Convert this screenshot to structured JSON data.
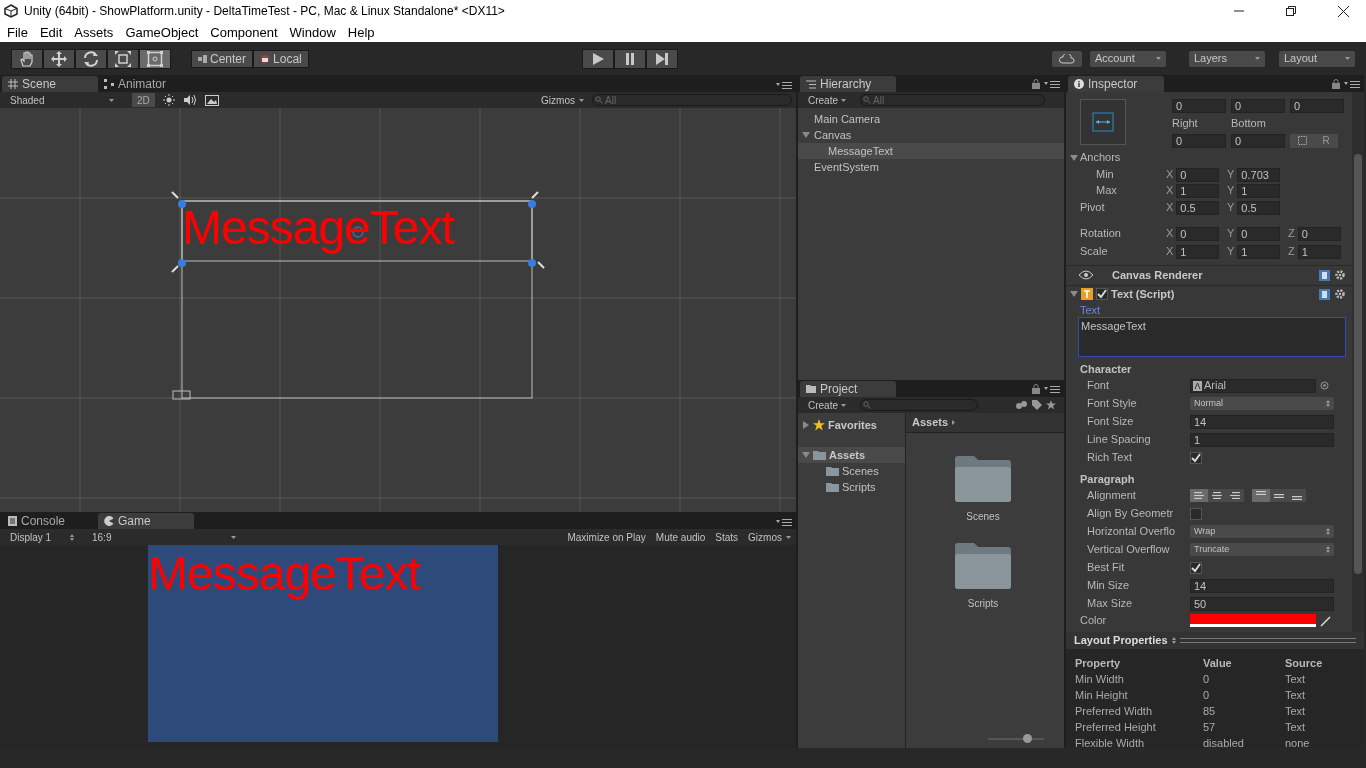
{
  "window": {
    "title": "Unity (64bit) - ShowPlatform.unity - DeltaTimeTest - PC, Mac & Linux Standalone* <DX11>"
  },
  "menu": [
    "File",
    "Edit",
    "Assets",
    "GameObject",
    "Component",
    "Window",
    "Help"
  ],
  "toolbar": {
    "tools": [
      {
        "kind": "hand",
        "selected": false
      },
      {
        "kind": "move",
        "selected": false
      },
      {
        "kind": "rotate",
        "selected": false
      },
      {
        "kind": "scale",
        "selected": false
      },
      {
        "kind": "rect",
        "selected": true
      }
    ],
    "pivot": [
      {
        "kind": "center",
        "label": "Center"
      },
      {
        "kind": "local",
        "label": "Local"
      }
    ],
    "play": [
      {
        "kind": "play",
        "selected": false
      },
      {
        "kind": "pause",
        "selected": false
      },
      {
        "kind": "step",
        "selected": false
      }
    ],
    "account": "Account",
    "layers": "Layers",
    "layout": "Layout"
  },
  "scene": {
    "tabs": [
      {
        "kind": "scene",
        "label": "Scene",
        "selected": true
      },
      {
        "kind": "animator",
        "label": "Animator",
        "selected": false
      }
    ],
    "shading": "Shaded",
    "mode_2d": {
      "label": "2D",
      "on": true
    },
    "gizmos": "Gizmos",
    "search_placeholder": "All",
    "text": "MessageText"
  },
  "game": {
    "tabs": [
      {
        "kind": "console",
        "label": "Console",
        "selected": false
      },
      {
        "kind": "game",
        "label": "Game",
        "selected": true
      }
    ],
    "display": "Display 1",
    "aspect": "16:9",
    "toggles": [
      {
        "label": "Maximize on Play",
        "on": false
      },
      {
        "label": "Mute audio",
        "on": false
      },
      {
        "label": "Stats",
        "on": false
      }
    ],
    "gizmos": "Gizmos",
    "text": "MessageText"
  },
  "hierarchy": {
    "tab": "Hierarchy",
    "create": "Create",
    "search_placeholder": "All",
    "items": [
      {
        "label": "Main Camera",
        "selected": false
      },
      {
        "label": "Canvas",
        "selected": false,
        "expanded": true,
        "children": [
          {
            "label": "MessageText",
            "selected": true
          }
        ]
      },
      {
        "label": "EventSystem",
        "selected": false
      }
    ]
  },
  "project": {
    "tab": "Project",
    "create": "Create",
    "tree": [
      {
        "kind": "favorites",
        "label": "Favorites",
        "selected": false,
        "expanded": false
      },
      {
        "kind": "assets",
        "label": "Assets",
        "selected": true,
        "expanded": true,
        "children": [
          {
            "label": "Scenes"
          },
          {
            "label": "Scripts"
          }
        ]
      }
    ],
    "breadcrumb": "Assets",
    "folders": [
      "Scenes",
      "Scripts"
    ],
    "zoom": {
      "level": 0.7
    }
  },
  "inspector": {
    "tab": "Inspector",
    "rect_top_values": [
      "0",
      "0",
      "0"
    ],
    "rect_labels": [
      "Right",
      "Bottom"
    ],
    "rect_values": [
      "0",
      "0"
    ],
    "raw_button": "R",
    "anchors": {
      "label": "Anchors",
      "expanded": true,
      "rows": [
        {
          "label": "Min",
          "values": [
            {
              "axis": "X",
              "value": "0"
            },
            {
              "axis": "Y",
              "value": "0.703"
            }
          ]
        },
        {
          "label": "Max",
          "values": [
            {
              "axis": "X",
              "value": "1"
            },
            {
              "axis": "Y",
              "value": "1"
            }
          ]
        }
      ]
    },
    "transform_rows": [
      {
        "label": "Pivot",
        "values": [
          {
            "axis": "X",
            "value": "0.5"
          },
          {
            "axis": "Y",
            "value": "0.5"
          }
        ]
      },
      {
        "label": "Rotation",
        "values": [
          {
            "axis": "X",
            "value": "0"
          },
          {
            "axis": "Y",
            "value": "0"
          },
          {
            "axis": "Z",
            "value": "0"
          }
        ]
      },
      {
        "label": "Scale",
        "values": [
          {
            "axis": "X",
            "value": "1"
          },
          {
            "axis": "Y",
            "value": "1"
          },
          {
            "axis": "Z",
            "value": "1"
          }
        ]
      }
    ],
    "canvas_renderer": "Canvas Renderer",
    "text_script": {
      "title": "Text (Script)",
      "enabled": true,
      "expanded": true,
      "text_label": "Text",
      "text_value": "MessageText",
      "sections": [
        {
          "title": "Character",
          "rows": [
            {
              "kind": "object",
              "label": "Font",
              "value": "Arial"
            },
            {
              "kind": "dropdown",
              "label": "Font Style",
              "value": "Normal"
            },
            {
              "kind": "text",
              "label": "Font Size",
              "value": "14"
            },
            {
              "kind": "text",
              "label": "Line Spacing",
              "value": "1"
            },
            {
              "kind": "checkbox",
              "label": "Rich Text",
              "checked": true
            }
          ]
        },
        {
          "title": "Paragraph",
          "rows": [
            {
              "kind": "alignment",
              "label": "Alignment",
              "horizontal": [
                {
                  "selected": true
                },
                {
                  "selected": false
                },
                {
                  "selected": false
                }
              ],
              "vertical": [
                {
                  "selected": true
                },
                {
                  "selected": false
                },
                {
                  "selected": false
                }
              ]
            },
            {
              "kind": "checkbox",
              "label": "Align By Geometr",
              "checked": false
            },
            {
              "kind": "dropdown",
              "label": "Horizontal Overflo",
              "value": "Wrap"
            },
            {
              "kind": "dropdown",
              "label": "Vertical Overflow",
              "value": "Truncate"
            },
            {
              "kind": "checkbox",
              "label": "Best Fit",
              "checked": true
            },
            {
              "kind": "text",
              "label": "Min Size",
              "value": "14"
            },
            {
              "kind": "text",
              "label": "Max Size",
              "value": "50"
            }
          ]
        }
      ],
      "color_label": "Color",
      "color": "#ff0000"
    },
    "layout_properties": {
      "title": "Layout Properties",
      "columns": [
        "Property",
        "Value",
        "Source"
      ],
      "rows": [
        [
          "Min Width",
          "0",
          "Text"
        ],
        [
          "Min Height",
          "0",
          "Text"
        ],
        [
          "Preferred Width",
          "85",
          "Text"
        ],
        [
          "Preferred Height",
          "57",
          "Text"
        ],
        [
          "Flexible Width",
          "disabled",
          "none"
        ]
      ]
    }
  }
}
